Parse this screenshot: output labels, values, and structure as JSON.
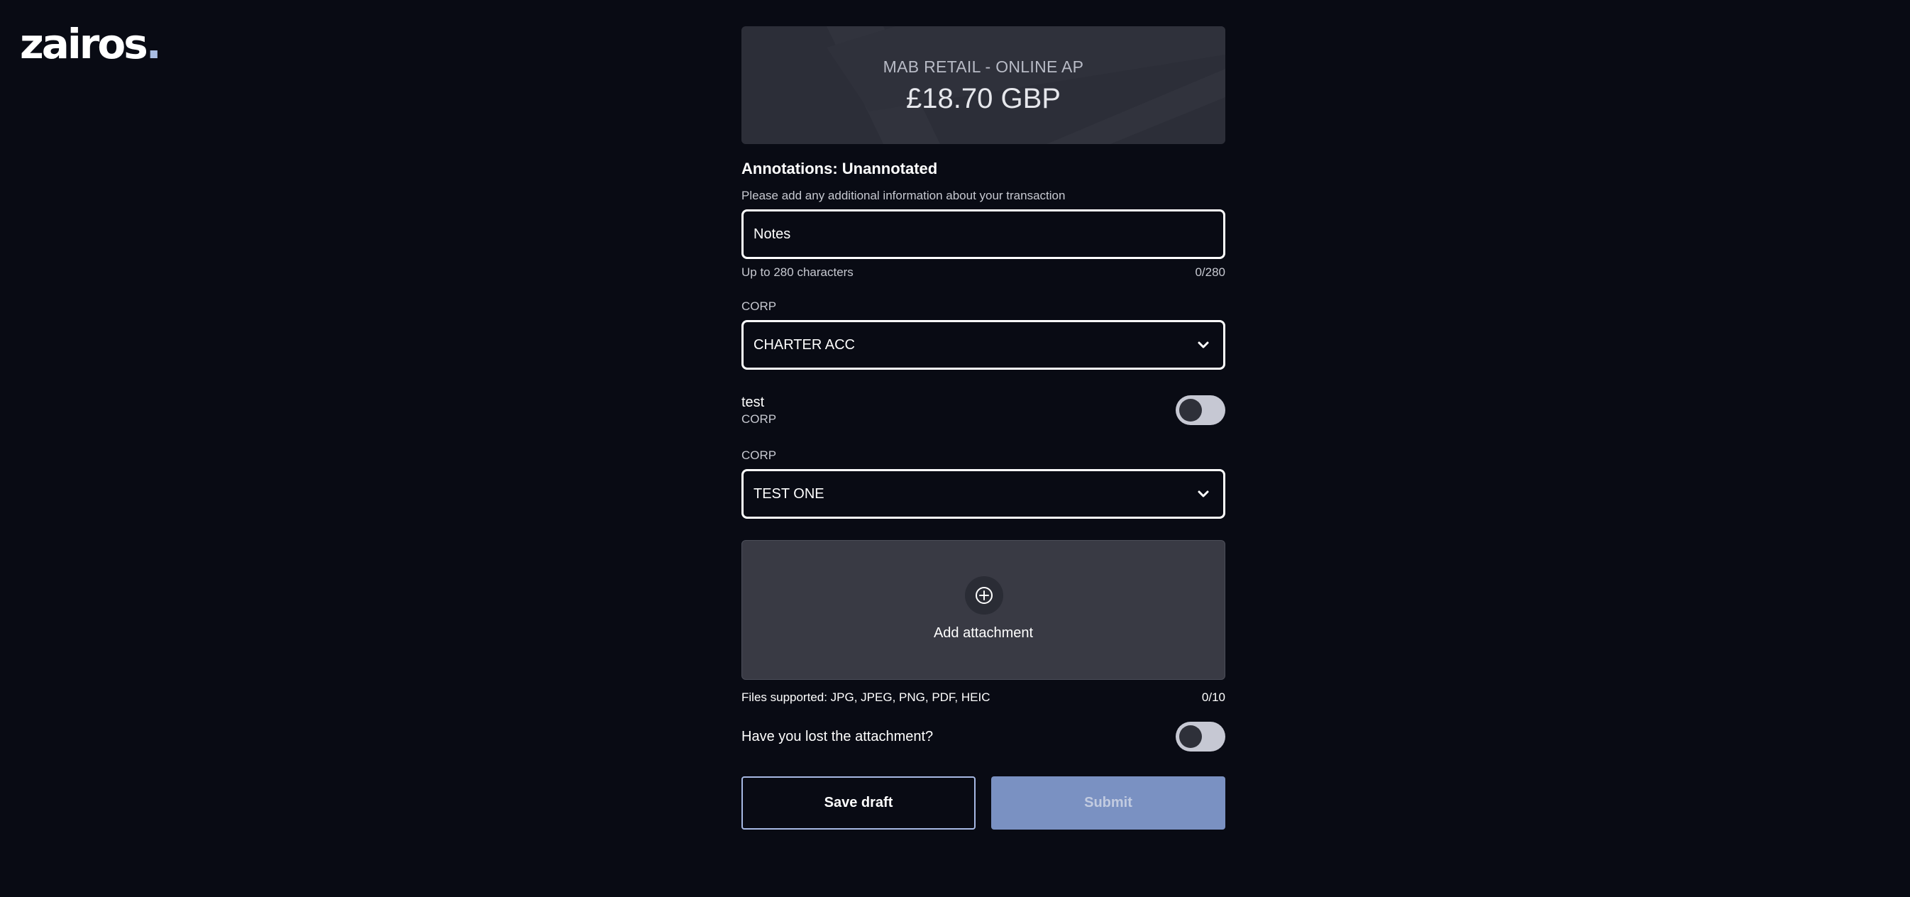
{
  "brand": {
    "logo_text": "zairos",
    "logo_dot": "."
  },
  "transaction": {
    "merchant": "MAB RETAIL - ONLINE AP",
    "amount": "£18.70 GBP"
  },
  "annotations": {
    "title": "Annotations: Unannotated",
    "help_text": "Please add any additional information about your transaction",
    "notes_placeholder": "Notes",
    "limit_text": "Up to 280 characters",
    "char_count": "0/280"
  },
  "corp_select_1": {
    "label": "CORP",
    "value": "CHARTER ACC"
  },
  "test_toggle": {
    "title": "test",
    "subtitle": "CORP",
    "on": false
  },
  "corp_select_2": {
    "label": "CORP",
    "value": "TEST ONE"
  },
  "attachment": {
    "label": "Add attachment",
    "supported": "Files supported: JPG, JPEG, PNG, PDF, HEIC",
    "count": "0/10"
  },
  "lost_attachment": {
    "label": "Have you lost the attachment?",
    "on": false
  },
  "actions": {
    "save_draft": "Save draft",
    "submit": "Submit"
  },
  "colors": {
    "background": "#090b14",
    "card": "#2c2e38",
    "submit_disabled": "#7a91c2",
    "toggle_track": "#c6c8d3"
  }
}
